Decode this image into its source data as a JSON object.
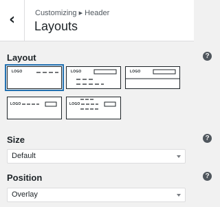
{
  "header": {
    "back_icon": "chevron-left-icon",
    "breadcrumb": "Customizing ▸ Header",
    "title": "Layouts"
  },
  "layout": {
    "label": "Layout",
    "help": "?",
    "selected_index": 0,
    "options": [
      {
        "logo": "LOGO"
      },
      {
        "logo": "LOGO"
      },
      {
        "logo": "LOGO"
      },
      {
        "logo": "LOGO"
      },
      {
        "logo": "LOGO"
      }
    ]
  },
  "size": {
    "label": "Size",
    "help": "?",
    "value": "Default"
  },
  "position": {
    "label": "Position",
    "help": "?",
    "value": "Overlay"
  },
  "colors": {
    "accent": "#2271b1",
    "background": "#f1f1f1"
  }
}
